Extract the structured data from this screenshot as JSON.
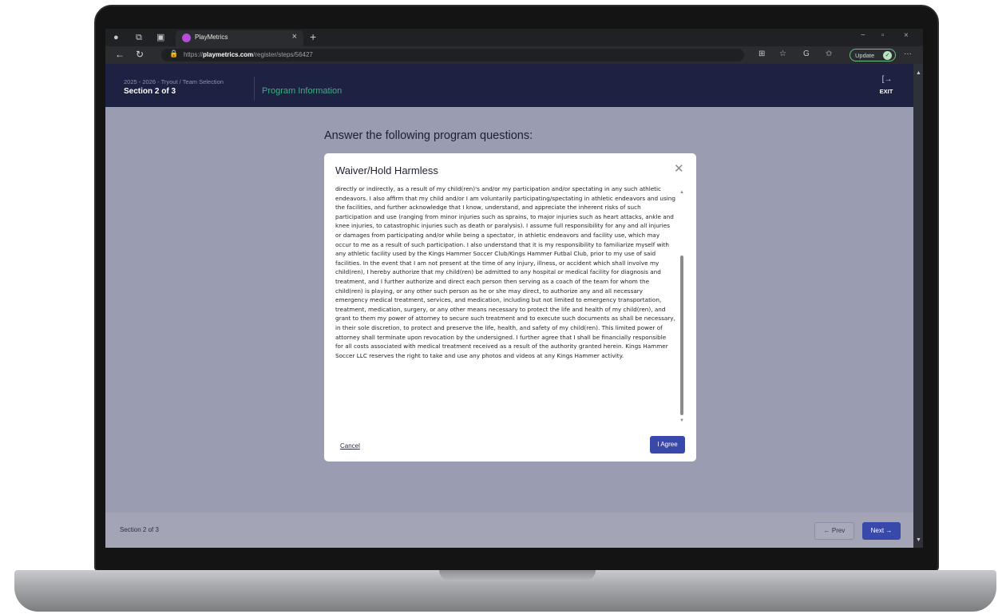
{
  "browser": {
    "tab_title": "PlayMetrics",
    "tab_close": "×",
    "new_tab": "+",
    "url_prefix": "https://",
    "url_domain": "playmetrics.com",
    "url_path": "/register/steps/56427",
    "update_label": "Update",
    "more_menu": "···",
    "window_controls": [
      "−",
      "▫",
      "×"
    ]
  },
  "header": {
    "breadcrumb": "2025 - 2026 - Tryout / Team Selection",
    "section": "Section 2 of 3",
    "program_title": "Program Information",
    "exit_label": "EXIT"
  },
  "page": {
    "heading": "Answer the following program questions:"
  },
  "modal": {
    "title": "Waiver/Hold Harmless",
    "body_text": "directly or indirectly, as a result of my child(ren)'s and/or my participation and/or spectating in any such athletic endeavors. I also affirm that my child and/or I am voluntarily participating/spectating in athletic endeavors and using the facilities, and further acknowledge that I know, understand, and appreciate the inherent risks of such participation and use (ranging from minor injuries such as sprains, to major injuries such as heart attacks, ankle and knee injuries, to catastrophic injuries such as death or paralysis). I assume full responsibility for any and all injuries or damages from participating and/or while being a spectator, in athletic endeavors and facility use, which may occur to me as a result of such participation. I also understand that it is my responsibility to familiarize myself with any athletic facility used by the Kings Hammer Soccer Club/Kings Hammer Futbal Club, prior to my use of said facilities. In the event that I am not present at the time of any injury, illness, or accident which shall involve my child(ren), I hereby authorize that my child(ren) be admitted to any hospital or medical facility for diagnosis and treatment, and I further authorize and direct each person then serving as a coach of the team for whom the child(ren) is playing, or any other such person as he or she may direct, to authorize any and all necessary emergency medical treatment, services, and medication, including but not limited to emergency transportation, treatment, medication, surgery, or any other means necessary to protect the life and health of my child(ren), and grant to them my power of attorney to secure such treatment and to execute such documents as shall be necessary, in their sole discretion, to protect and preserve the life, health, and safety of my child(ren). This limited power of attorney shall terminate upon revocation by the undersigned. I further agree that I shall be financially responsible for all costs associated with medical treatment received as a result of the authority granted herein. Kings Hammer Soccer LLC reserves the right to take and use any photos and videos at any Kings Hammer activity.",
    "cancel_label": "Cancel",
    "agree_label": "I Agree"
  },
  "footer": {
    "section": "Section 2 of 3",
    "prev_label": "← Prev",
    "next_label": "Next →"
  },
  "colors": {
    "header_bg": "#1d2142",
    "accent_green": "#36b37e",
    "primary_button": "#3949ab",
    "overlay": "#9a9cb1"
  }
}
